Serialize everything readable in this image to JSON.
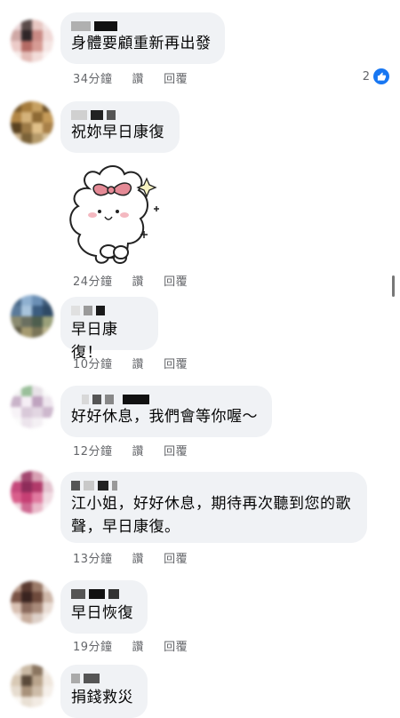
{
  "comments": [
    {
      "text": "身體要顧重新再出發",
      "time": "34分鐘",
      "like_label": "讚",
      "reply_label": "回覆",
      "reaction_count": "2",
      "colors": [
        "#e9d3d4",
        "#5a4b4a",
        "#e7c7c2",
        "#f3e4e3",
        "#cfa8a5",
        "#2f2628",
        "#c98a84",
        "#f0d8d6",
        "#eccbc8",
        "#b46a64",
        "#d69b94",
        "#f5e6e4",
        "#f7ecea",
        "#e3bcb7",
        "#f2dcd9",
        "#fbf3f2"
      ]
    },
    {
      "text": "祝妳早日康復",
      "time": "24分鐘",
      "like_label": "讚",
      "reply_label": "回覆",
      "colors": [
        "#7a5a2a",
        "#a67c3c",
        "#c6a061",
        "#6b4e25",
        "#b28645",
        "#d4b27a",
        "#8e6a34",
        "#c49a58",
        "#5a4220",
        "#9c7a46",
        "#e0c089",
        "#a88048",
        "#c9b08a",
        "#7b6238",
        "#b59a6a",
        "#d7c29c"
      ]
    },
    {
      "text": "早日康復！",
      "time": "10分鐘",
      "like_label": "讚",
      "reply_label": "回覆",
      "colors": [
        "#4a6a8a",
        "#8fb0d0",
        "#6b8fb5",
        "#3d5a78",
        "#5a7a9a",
        "#a8c4dc",
        "#3c5d80",
        "#2f4a66",
        "#8a8a70",
        "#6a6f60",
        "#4e5e4e",
        "#9aa07a",
        "#5e5a44",
        "#a59a70",
        "#7a7558",
        "#bcb58f"
      ]
    },
    {
      "text": "好好休息，我們會等你喔～",
      "time": "12分鐘",
      "like_label": "讚",
      "reply_label": "回覆",
      "colors": [
        "#f2f2f2",
        "#9abf9a",
        "#e8e2e8",
        "#fafafa",
        "#c9b3c9",
        "#f5eef5",
        "#bfa3bf",
        "#eee6ee",
        "#f7f3f7",
        "#d9c9d9",
        "#e2d6e2",
        "#cdb8cd",
        "#fafafa",
        "#ece4ec",
        "#f4f0f4",
        "#fdfdfd"
      ]
    },
    {
      "text": "江小姐，好好休息，期待再次聽到您的歌聲，早日康復。",
      "time": "13分鐘",
      "like_label": "讚",
      "reply_label": "回覆",
      "colors": [
        "#e9d6da",
        "#a34870",
        "#d7a0b3",
        "#f2e6e9",
        "#c5497c",
        "#8e2c5a",
        "#b13a6a",
        "#e4c3cf",
        "#d95f8c",
        "#c63f74",
        "#e07aa0",
        "#f0dbe2",
        "#efd4dd",
        "#cf6a92",
        "#e9b9c9",
        "#f6eaee"
      ]
    },
    {
      "text": "早日恢復",
      "time": "19分鐘",
      "like_label": "讚",
      "reply_label": "回覆",
      "colors": [
        "#b89a8a",
        "#5a3a30",
        "#9a7a68",
        "#e6d8d0",
        "#7a5446",
        "#3a2420",
        "#6e4a3c",
        "#cdb6a8",
        "#d8c0b2",
        "#8a6a5c",
        "#a88a7a",
        "#e9dcd4",
        "#efe4de",
        "#c8ae9e",
        "#ddd0c8",
        "#f5eeea"
      ]
    },
    {
      "text": "捐錢救災",
      "time": "",
      "like_label": "",
      "reply_label": "",
      "colors": [
        "#ece4da",
        "#c9b9a4",
        "#8a7560",
        "#f4ede6",
        "#d8c9b5",
        "#5a4a3a",
        "#b9a48c",
        "#efe6dc",
        "#e6dccf",
        "#a8927a",
        "#cdbca8",
        "#f5efe9",
        "#faf7f3",
        "#e9e0d4",
        "#f2ebe3",
        "#fcfaf8"
      ]
    }
  ]
}
